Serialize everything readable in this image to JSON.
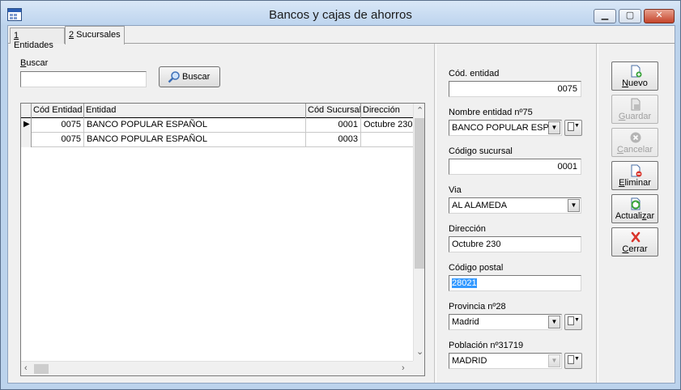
{
  "window": {
    "title": "Bancos y cajas de ahorros"
  },
  "tabs": [
    {
      "key": "1",
      "label": " Entidades"
    },
    {
      "key": "2",
      "label": " Sucursales"
    }
  ],
  "search": {
    "label_key": "B",
    "label_rest": "uscar",
    "value": "",
    "button_label": "Buscar"
  },
  "grid": {
    "columns": [
      "Cód Entidad",
      "Entidad",
      "Cód Sucursal",
      "Dirección"
    ],
    "rows": [
      {
        "cod_entidad": "0075",
        "entidad": "BANCO POPULAR ESPAÑOL",
        "cod_sucursal": "0001",
        "direccion": "Octubre 230",
        "current": true
      },
      {
        "cod_entidad": "0075",
        "entidad": "BANCO POPULAR ESPAÑOL",
        "cod_sucursal": "0003",
        "direccion": "",
        "current": false
      }
    ]
  },
  "form": {
    "cod_entidad": {
      "label": "Cód. entidad",
      "value": "0075"
    },
    "nombre_entidad": {
      "label": "Nombre entidad nº75",
      "value": "BANCO POPULAR ESP."
    },
    "codigo_sucursal": {
      "label": "Código sucursal",
      "value": "0001"
    },
    "via": {
      "label": "Via",
      "value": "AL ALAMEDA"
    },
    "direccion": {
      "label": "Dirección",
      "value": "Octubre 230"
    },
    "codigo_postal": {
      "label": "Código postal",
      "value": "28021"
    },
    "provincia": {
      "label": "Provincia nº28",
      "value": "Madrid"
    },
    "poblacion": {
      "label": "Población nº31719",
      "value": "MADRID"
    }
  },
  "actions": [
    {
      "pre": "",
      "key": "N",
      "post": "uevo",
      "enabled": true,
      "icon": "new-document-icon"
    },
    {
      "pre": "",
      "key": "G",
      "post": "uardar",
      "enabled": false,
      "icon": "save-document-icon"
    },
    {
      "pre": "",
      "key": "C",
      "post": "ancelar",
      "enabled": false,
      "icon": "cancel-icon"
    },
    {
      "pre": "",
      "key": "E",
      "post": "liminar",
      "enabled": true,
      "icon": "delete-document-icon"
    },
    {
      "pre": "Actuali",
      "key": "z",
      "post": "ar",
      "enabled": true,
      "icon": "refresh-icon"
    },
    {
      "pre": "",
      "key": "C",
      "post": "errar",
      "enabled": true,
      "icon": "close-x-icon"
    }
  ]
}
